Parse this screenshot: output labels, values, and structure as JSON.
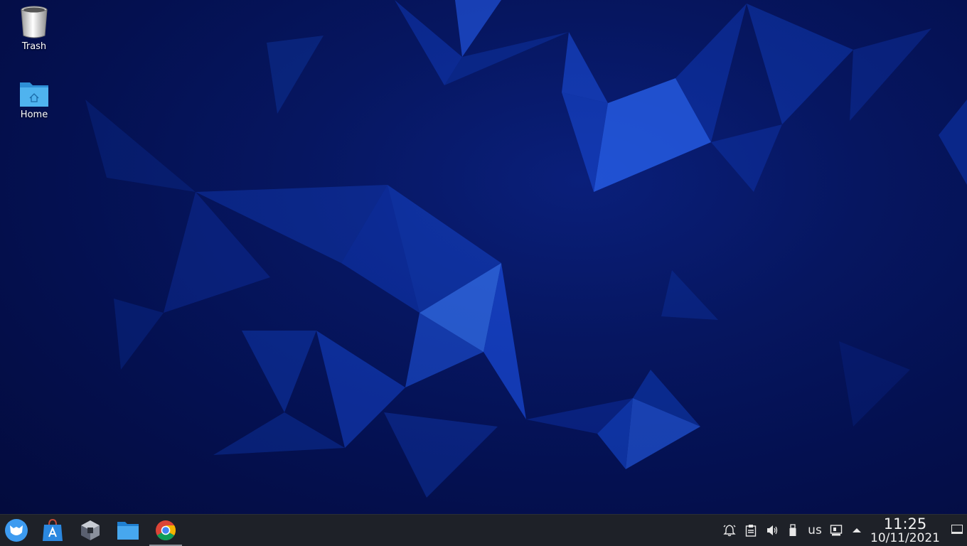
{
  "desktop": {
    "icons": [
      {
        "label": "Trash",
        "icon": "trash-icon"
      },
      {
        "label": "Home",
        "icon": "home-folder-icon"
      }
    ]
  },
  "taskbar": {
    "launchers": [
      {
        "name": "application-launcher",
        "icon": "app-menu-icon"
      },
      {
        "name": "software-store",
        "icon": "store-icon"
      },
      {
        "name": "virtual-machine-app",
        "icon": "cube-icon"
      },
      {
        "name": "file-manager",
        "icon": "folder-icon"
      },
      {
        "name": "chrome-browser",
        "icon": "chrome-icon",
        "active": true
      }
    ],
    "tray": {
      "icons": [
        "notifications-icon",
        "clipboard-icon",
        "volume-icon",
        "usb-icon"
      ],
      "keyboard_layout": "us",
      "network_icon": "network-icon",
      "expand_icon": "chevron-up-icon"
    },
    "clock": {
      "time": "11:25",
      "date": "10/11/2021"
    }
  },
  "colors": {
    "taskbar": "#1e2128",
    "wallpaper_dark": "#030b3d",
    "wallpaper_accent": "#1d5cff"
  }
}
